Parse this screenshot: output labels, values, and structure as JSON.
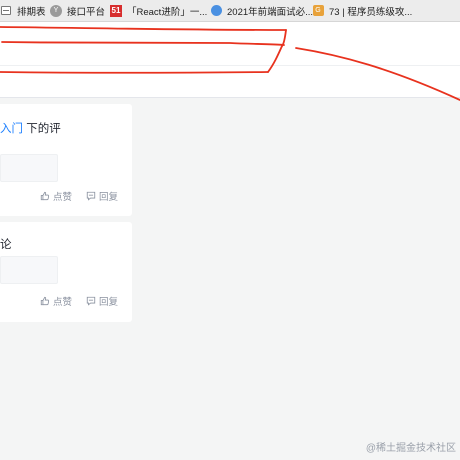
{
  "bookmarks": [
    {
      "icon": "list-icon",
      "label": "排期表"
    },
    {
      "icon": "interface-icon",
      "label": "接口平台"
    },
    {
      "icon": "fiftyone-icon",
      "label": "「React进阶」一..."
    },
    {
      "icon": "globe-icon",
      "label": "2021年前端面试必..."
    },
    {
      "icon": "seventythree-icon",
      "label": "73 | 程序员练级攻..."
    }
  ],
  "comments": [
    {
      "title_link": "入门",
      "title_rest": " 下的评",
      "like_label": "点赞",
      "reply_label": "回复"
    },
    {
      "title_link": "",
      "title_rest": "论",
      "like_label": "点赞",
      "reply_label": "回复"
    }
  ],
  "watermark": "@稀土掘金技术社区",
  "colors": {
    "page_bg": "#f4f5f5",
    "card_bg": "#ffffff",
    "link": "#1e80ff",
    "muted": "#8a919f",
    "markup": "#e8321e"
  }
}
